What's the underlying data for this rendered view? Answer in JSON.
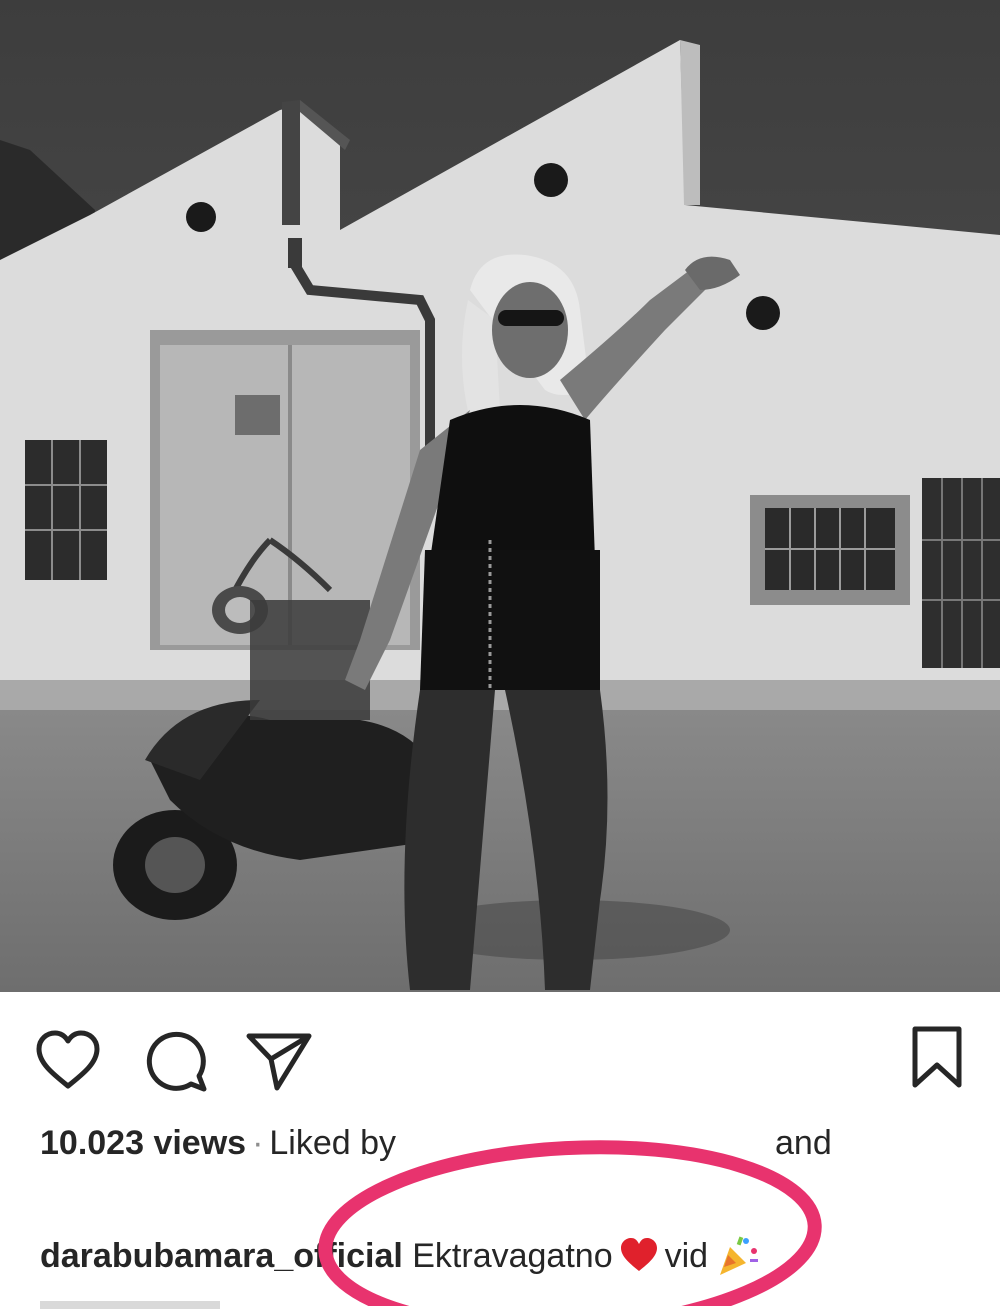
{
  "post": {
    "views": "10.023 views",
    "separator": "·",
    "liked_by": "Liked by",
    "and": "and",
    "username": "darabubamara_official",
    "caption_text": "Ektravagatno",
    "caption_tail": "vid"
  },
  "icons": {
    "like": "heart-outline-icon",
    "comment": "comment-bubble-icon",
    "share": "paper-plane-icon",
    "save": "bookmark-icon",
    "caption_emoji_1": "red-heart-emoji",
    "caption_emoji_2": "party-popper-emoji"
  },
  "colors": {
    "text": "#262626",
    "muted": "#8e8e8e",
    "highlight_ring": "#e8336e",
    "heart_emoji": "#e0212c"
  }
}
